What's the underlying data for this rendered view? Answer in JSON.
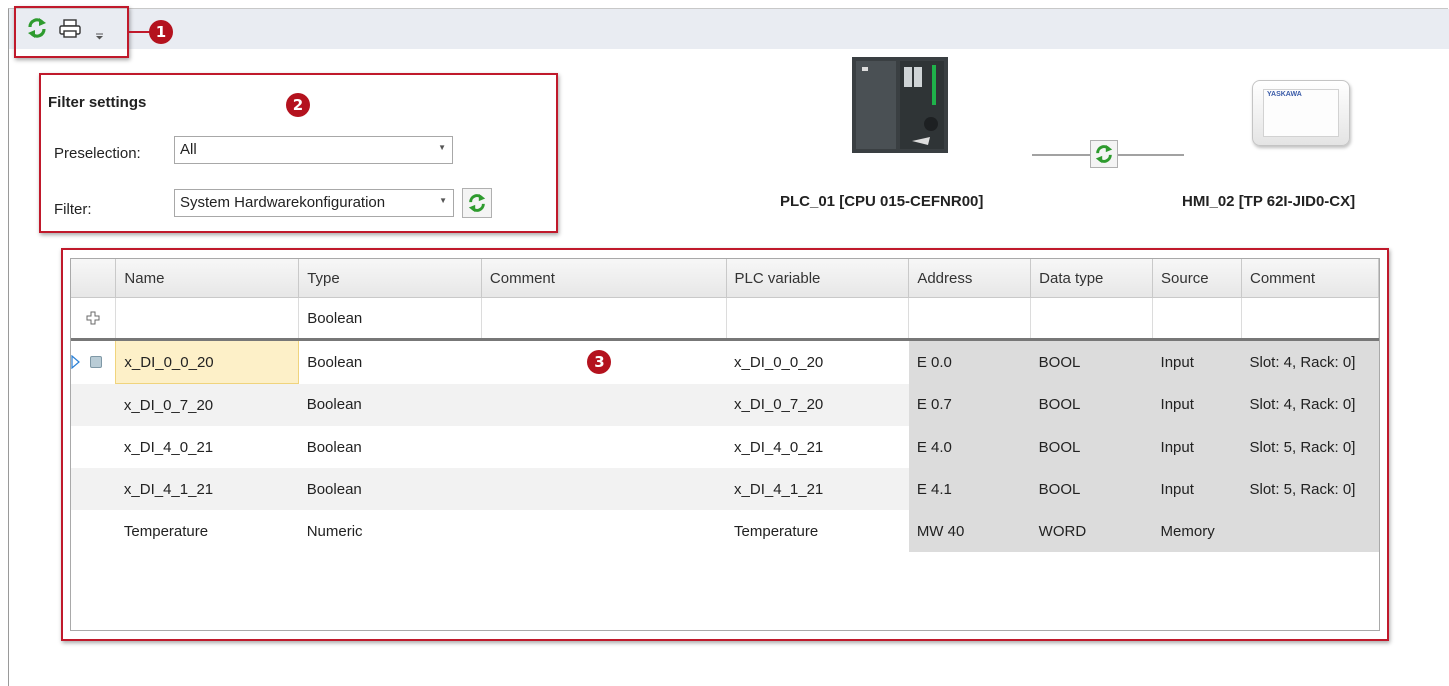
{
  "toolbar": {
    "refresh_icon": "refresh-icon",
    "print_icon": "print-icon",
    "overflow_icon": "overflow-chevron-icon",
    "badge": "1"
  },
  "filter": {
    "title": "Filter settings",
    "badge": "2",
    "preselection_label": "Preselection:",
    "preselection_value": "All",
    "filter_label": "Filter:",
    "filter_value": "System Hardwarekonfiguration"
  },
  "devices": {
    "plc_name": "PLC_01 [CPU 015-CEFNR00]",
    "hmi_name": "HMI_02 [TP 62I-JID0-CX]",
    "hmi_brand": "YASKAWA"
  },
  "grid": {
    "badge": "3",
    "columns": [
      "Name",
      "Type",
      "Comment",
      "PLC variable",
      "Address",
      "Data type",
      "Source",
      "Comment"
    ],
    "new_row": {
      "type": "Boolean"
    },
    "rows": [
      {
        "name": "x_DI_0_0_20",
        "type": "Boolean",
        "comment": "",
        "plc_variable": "x_DI_0_0_20",
        "address": "E 0.0",
        "data_type": "BOOL",
        "source": "Input",
        "comment2": "Slot: 4, Rack: 0]"
      },
      {
        "name": "x_DI_0_7_20",
        "type": "Boolean",
        "comment": "",
        "plc_variable": "x_DI_0_7_20",
        "address": "E 0.7",
        "data_type": "BOOL",
        "source": "Input",
        "comment2": "Slot: 4, Rack: 0]"
      },
      {
        "name": "x_DI_4_0_21",
        "type": "Boolean",
        "comment": "",
        "plc_variable": "x_DI_4_0_21",
        "address": "E 4.0",
        "data_type": "BOOL",
        "source": "Input",
        "comment2": "Slot: 5, Rack: 0]"
      },
      {
        "name": "x_DI_4_1_21",
        "type": "Boolean",
        "comment": "",
        "plc_variable": "x_DI_4_1_21",
        "address": "E 4.1",
        "data_type": "BOOL",
        "source": "Input",
        "comment2": "Slot: 5, Rack: 0]"
      },
      {
        "name": "Temperature",
        "type": "Numeric",
        "comment": "",
        "plc_variable": "Temperature",
        "address": "MW 40",
        "data_type": "WORD",
        "source": "Memory",
        "comment2": ""
      }
    ]
  },
  "colors": {
    "annotation_red": "#c0192b",
    "refresh_green": "#2e9b2e",
    "selected_cell": "#fdf0c8",
    "system_cell": "#dcdcdc"
  }
}
